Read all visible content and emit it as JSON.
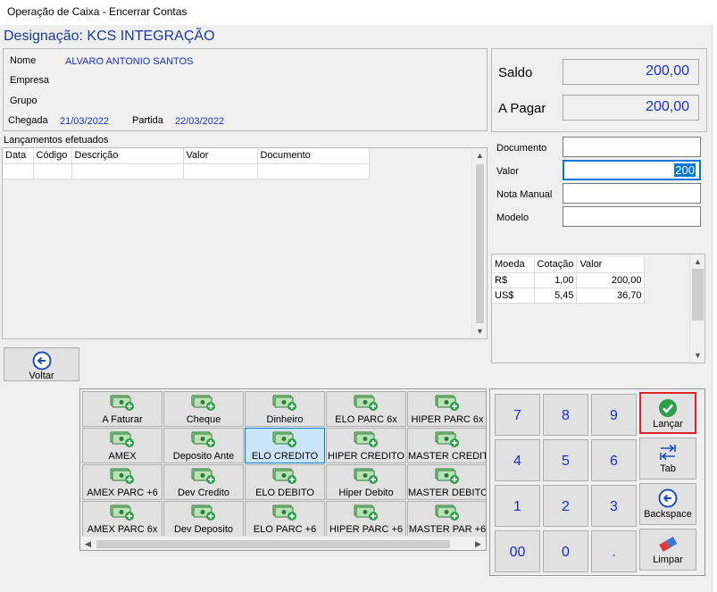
{
  "window": {
    "title": "Operação de Caixa - Encerrar Contas"
  },
  "header": {
    "designacao": "Designação: KCS INTEGRAÇÃO"
  },
  "guest": {
    "nome_label": "Nome",
    "nome": "ALVARO ANTONIO SANTOS",
    "empresa_label": "Empresa",
    "grupo_label": "Grupo",
    "chegada_label": "Chegada",
    "chegada": "21/03/2022",
    "partida_label": "Partida",
    "partida": "22/03/2022"
  },
  "totals": {
    "saldo_label": "Saldo",
    "saldo": "200,00",
    "apagar_label": "A Pagar",
    "apagar": "200,00"
  },
  "lancamentos": {
    "title": "Lançamentos efetuados",
    "columns": [
      "Data",
      "Código",
      "Descrição",
      "Valor",
      "Documento"
    ]
  },
  "form": {
    "documento_label": "Documento",
    "documento": "",
    "valor_label": "Valor",
    "valor": "200",
    "nota_label": "Nota Manual",
    "nota": "",
    "modelo_label": "Modelo",
    "modelo": ""
  },
  "currency": {
    "columns": [
      "Moeda",
      "Cotação",
      "Valor"
    ],
    "rows": [
      [
        "R$",
        "1,00",
        "200,00"
      ],
      [
        "US$",
        "5,45",
        "36,70"
      ]
    ]
  },
  "voltar": {
    "label": "Voltar"
  },
  "payments": [
    [
      "A Faturar",
      "Cheque",
      "Dinheiro",
      "ELO PARC 6x",
      "HIPER PARC 6x"
    ],
    [
      "AMEX",
      "Deposito Ante",
      "ELO CREDITO",
      "HIPER CREDITO",
      "MASTER CREDIT"
    ],
    [
      "AMEX PARC +6",
      "Dev Credito",
      "ELO DEBITO",
      "Hiper Debito",
      "MASTER DEBITO"
    ],
    [
      "AMEX PARC 6x",
      "Dev Deposito",
      "ELO PARC +6",
      "HIPER PARC +6",
      "MASTER PAR +6"
    ]
  ],
  "keypad": {
    "digits": [
      [
        "7",
        "8",
        "9"
      ],
      [
        "4",
        "5",
        "6"
      ],
      [
        "1",
        "2",
        "3"
      ],
      [
        "00",
        "0",
        "."
      ]
    ],
    "lancar": "Lançar",
    "tab": "Tab",
    "backspace": "Backspace",
    "limpar": "Limpar"
  },
  "colors": {
    "accent": "#1b2fc8",
    "highlight": "#e0202a",
    "selected": "#cce4f7"
  }
}
